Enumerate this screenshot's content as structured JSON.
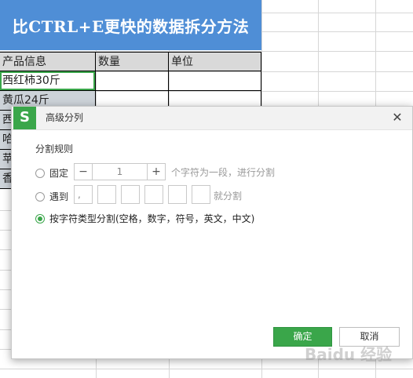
{
  "banner": {
    "title": "比CTRL+E更快的数据拆分方法"
  },
  "table": {
    "headers": [
      "产品信息",
      "数量",
      "单位"
    ],
    "rows": [
      [
        "西红柿30斤",
        "",
        ""
      ],
      [
        "黄瓜24斤",
        "",
        ""
      ],
      [
        "西",
        "",
        ""
      ],
      [
        "哈",
        "",
        ""
      ],
      [
        "苹",
        "",
        ""
      ],
      [
        "香",
        "",
        ""
      ]
    ]
  },
  "dialog": {
    "logo": "S",
    "title": "高级分列",
    "close_icon": "✕",
    "section_label": "分割规则",
    "fixed": {
      "label": "固定",
      "minus": "−",
      "value": "1",
      "plus": "+",
      "suffix": "个字符为一段，进行分割",
      "checked": false
    },
    "delimiter": {
      "label": "遇到",
      "boxes": [
        ",",
        "",
        "",
        "",
        "",
        ""
      ],
      "suffix": "就分割",
      "checked": false
    },
    "by_type": {
      "label": "按字符类型分割(空格，数字，符号，英文，中文)",
      "checked": true
    },
    "ok_label": "确定",
    "cancel_label": "取消"
  },
  "watermark": "Baidu 经验"
}
